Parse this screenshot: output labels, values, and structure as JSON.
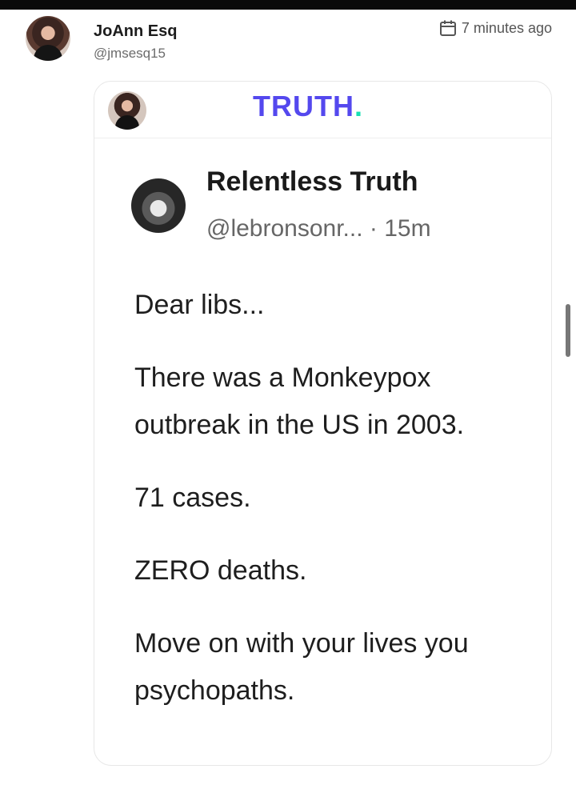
{
  "author": {
    "name": "JoAnn Esq",
    "handle": "@jmsesq15",
    "time": "7 minutes ago",
    "time_icon": "calendar-icon"
  },
  "card": {
    "platform_logo": "TRUTH",
    "platform_logo_dot": ".",
    "brand_color": "#5448ee",
    "brand_dot_color": "#17e0b3",
    "post": {
      "name": "Relentless Truth",
      "meta": "@lebronsonr... · 15m",
      "paragraphs": [
        "Dear libs...",
        "There was a Monkeypox outbreak in the US in 2003.",
        "71 cases.",
        "ZERO deaths.",
        "Move on with your lives you psychopaths."
      ]
    }
  }
}
